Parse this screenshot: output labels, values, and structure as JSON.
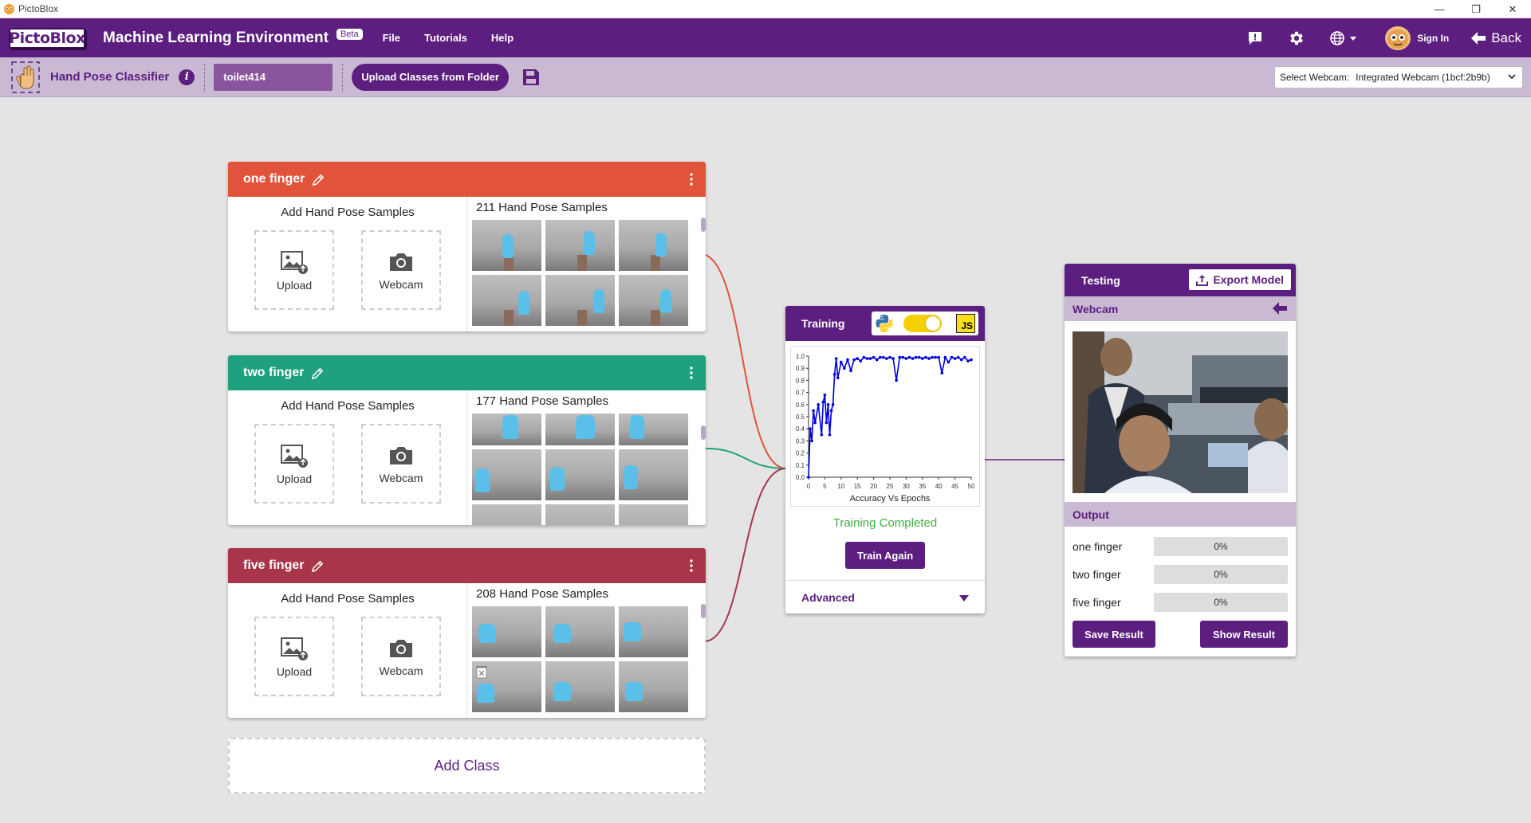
{
  "window": {
    "title": "PictoBlox"
  },
  "header": {
    "logo": "PictoBlox",
    "title": "Machine Learning Environment",
    "badge": "Beta",
    "menu": [
      "File",
      "Tutorials",
      "Help"
    ],
    "sign_in": "Sign In",
    "back": "Back"
  },
  "toolbar": {
    "title": "Hand Pose Classifier",
    "info": "i",
    "project_name": "toilet414",
    "upload_folder": "Upload Classes from Folder",
    "webcam_label": "Select Webcam:",
    "webcam_value": "Integrated Webcam (1bcf:2b9b)"
  },
  "classes": [
    {
      "name": "one finger",
      "color": "#e1533a",
      "add_title": "Add Hand Pose Samples",
      "upload": "Upload",
      "webcam": "Webcam",
      "samples": "211 Hand Pose Samples"
    },
    {
      "name": "two finger",
      "color": "#1fa07e",
      "add_title": "Add Hand Pose Samples",
      "upload": "Upload",
      "webcam": "Webcam",
      "samples": "177 Hand Pose Samples"
    },
    {
      "name": "five finger",
      "color": "#a8354a",
      "add_title": "Add Hand Pose Samples",
      "upload": "Upload",
      "webcam": "Webcam",
      "samples": "208 Hand Pose Samples"
    }
  ],
  "add_class": "Add Class",
  "training": {
    "title": "Training",
    "js_label": "JS",
    "status": "Training Completed",
    "train_again": "Train Again",
    "advanced": "Advanced"
  },
  "chart_data": {
    "type": "line",
    "title": "",
    "xlabel": "Accuracy Vs Epochs",
    "ylabel": "",
    "xlim": [
      0,
      50
    ],
    "ylim": [
      0,
      1.0
    ],
    "x_ticks": [
      0,
      5,
      10,
      15,
      20,
      25,
      30,
      35,
      40,
      45,
      50
    ],
    "y_ticks": [
      0.0,
      0.1,
      0.2,
      0.3,
      0.4,
      0.5,
      0.6,
      0.7,
      0.8,
      0.9,
      1.0
    ],
    "series": [
      {
        "color": "#0000dd",
        "x": [
          0,
          0.5,
          1,
          1.5,
          2,
          3,
          4,
          4.5,
          5,
          5.5,
          6,
          6.5,
          7,
          7.5,
          8,
          8.5,
          9,
          10,
          11,
          12,
          13,
          14,
          15,
          16,
          17,
          18,
          19,
          20,
          21,
          22,
          23,
          24,
          25,
          26,
          27,
          28,
          29,
          30,
          31,
          32,
          33,
          34,
          35,
          36,
          37,
          38,
          39,
          40,
          41,
          42,
          43,
          44,
          45,
          46,
          47,
          48,
          49,
          50
        ],
        "y": [
          0.0,
          0.4,
          0.3,
          0.55,
          0.45,
          0.6,
          0.35,
          0.62,
          0.68,
          0.45,
          0.6,
          0.35,
          0.55,
          0.6,
          0.85,
          0.98,
          0.82,
          0.95,
          0.9,
          0.97,
          0.88,
          0.97,
          0.98,
          0.96,
          0.99,
          0.98,
          0.98,
          0.99,
          0.97,
          0.99,
          0.99,
          0.98,
          0.99,
          0.98,
          0.8,
          0.99,
          0.99,
          0.98,
          0.99,
          0.98,
          0.99,
          0.99,
          0.98,
          0.99,
          0.98,
          0.99,
          0.99,
          0.99,
          0.86,
          0.99,
          0.95,
          0.99,
          0.98,
          0.99,
          0.97,
          0.99,
          0.96,
          0.97
        ]
      }
    ]
  },
  "testing": {
    "title": "Testing",
    "export": "Export Model",
    "webcam": "Webcam",
    "output": "Output",
    "results": [
      {
        "label": "one finger",
        "value": "0%",
        "fraction": 0
      },
      {
        "label": "two finger",
        "value": "0%",
        "fraction": 0
      },
      {
        "label": "five finger",
        "value": "0%",
        "fraction": 0
      }
    ],
    "save_result": "Save Result",
    "show_result": "Show Result"
  }
}
